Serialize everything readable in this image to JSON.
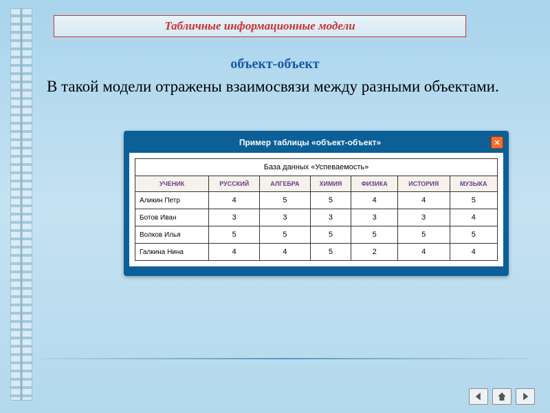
{
  "titleBar": "Табличные информационные модели",
  "subtitle": "объект-объект",
  "bodyText": "В такой модели отражены взаимосвязи между разными объектами.",
  "tableWindow": {
    "header": "Пример таблицы «объект-объект»",
    "closeLabel": "✕",
    "dbTitle": "База данных   «Успеваемость»",
    "columns": [
      "УЧЕНИК",
      "РУССКИЙ",
      "АЛГЕБРА",
      "ХИМИЯ",
      "ФИЗИКА",
      "ИСТОРИЯ",
      "МУЗЫКА"
    ],
    "rows": [
      {
        "name": "Аликин Петр",
        "grades": [
          4,
          5,
          5,
          4,
          4,
          5
        ]
      },
      {
        "name": "Ботов Иван",
        "grades": [
          3,
          3,
          3,
          3,
          3,
          4
        ]
      },
      {
        "name": "Волков Илья",
        "grades": [
          5,
          5,
          5,
          5,
          5,
          5
        ]
      },
      {
        "name": "Галкина Нина",
        "grades": [
          4,
          4,
          5,
          2,
          4,
          4
        ]
      }
    ]
  },
  "nav": {
    "prev": "prev",
    "home": "home",
    "next": "next"
  }
}
